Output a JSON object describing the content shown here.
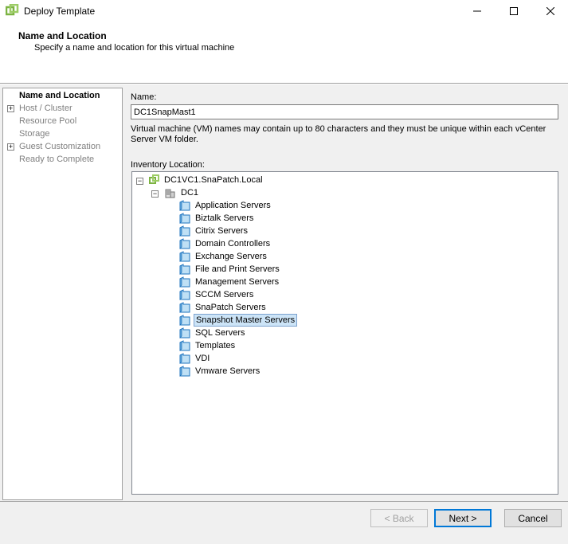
{
  "window": {
    "title": "Deploy Template"
  },
  "header": {
    "title": "Name and Location",
    "subtitle": "Specify a name and location for this virtual machine"
  },
  "steps": [
    {
      "label": "Name and Location",
      "active": true,
      "expandable": false
    },
    {
      "label": "Host / Cluster",
      "active": false,
      "expandable": true
    },
    {
      "label": "Resource Pool",
      "active": false,
      "expandable": false
    },
    {
      "label": "Storage",
      "active": false,
      "expandable": false
    },
    {
      "label": "Guest Customization",
      "active": false,
      "expandable": true
    },
    {
      "label": "Ready to Complete",
      "active": false,
      "expandable": false
    }
  ],
  "form": {
    "name_label": "Name:",
    "name_value": "DC1SnapMast1",
    "hint": "Virtual machine (VM) names may contain up to 80 characters and they must be unique within each vCenter Server VM folder.",
    "inventory_label": "Inventory Location:"
  },
  "tree": {
    "root": "DC1VC1.SnaPatch.Local",
    "datacenter": "DC1",
    "folders": [
      "Application Servers",
      "Biztalk Servers",
      "Citrix Servers",
      "Domain Controllers",
      "Exchange Servers",
      "File and Print Servers",
      "Management Servers",
      "SCCM Servers",
      "SnaPatch Servers",
      "Snapshot Master Servers",
      "SQL Servers",
      "Templates",
      "VDI",
      "Vmware Servers"
    ],
    "selected": "Snapshot Master Servers"
  },
  "buttons": {
    "back": "< Back",
    "next": "Next >",
    "cancel": "Cancel"
  },
  "colors": {
    "accent": "#0078d7",
    "selection": "#cce4f7",
    "vcenter_green": "#7cb342"
  }
}
